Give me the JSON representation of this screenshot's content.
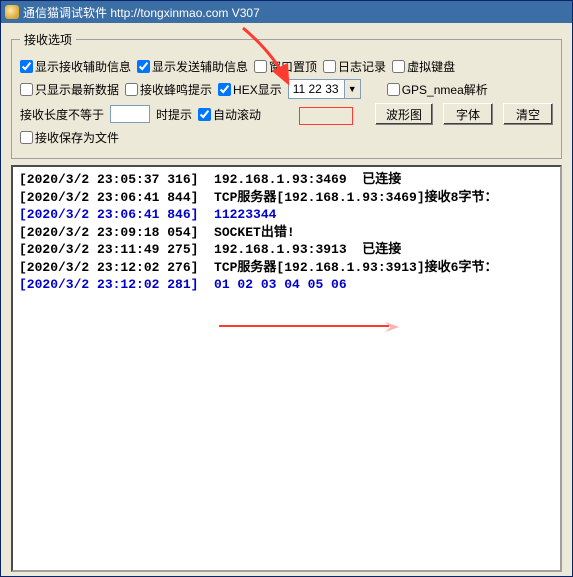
{
  "title": "通信猫调试软件  http://tongxinmao.com  V307",
  "options": {
    "legend": "接收选项",
    "row1": {
      "show_recv_aux": {
        "label": "显示接收辅助信息",
        "checked": true
      },
      "show_send_aux": {
        "label": "显示发送辅助信息",
        "checked": true
      },
      "window_top": {
        "label": "窗口置顶",
        "checked": false
      },
      "log_record": {
        "label": "日志记录",
        "checked": false
      },
      "virtual_kb": {
        "label": "虚拟键盘",
        "checked": false
      }
    },
    "row2": {
      "only_latest": {
        "label": "只显示最新数据",
        "checked": false
      },
      "beep": {
        "label": "接收蜂鸣提示",
        "checked": false
      },
      "hex": {
        "label": "HEX显示",
        "checked": true
      },
      "combo_value": "11 22 33",
      "gps": {
        "label": "GPS_nmea解析",
        "checked": false
      }
    },
    "row3": {
      "len_ne_label": "接收长度不等于",
      "len_ne_value": "",
      "time_tip_label": "时提示",
      "auto_scroll": {
        "label": "自动滚动",
        "checked": true
      },
      "btn_wave": "波形图",
      "btn_font": "字体",
      "btn_clear": "清空"
    },
    "row4": {
      "save_as_file": {
        "label": "接收保存为文件",
        "checked": false
      }
    }
  },
  "log": [
    {
      "cls": "black",
      "text": "[2020/3/2 23:05:37 316]  192.168.1.93:3469  已连接"
    },
    {
      "cls": "black",
      "text": "[2020/3/2 23:06:41 844]  TCP服务器[192.168.1.93:3469]接收8字节："
    },
    {
      "cls": "blue",
      "text": "[2020/3/2 23:06:41 846]  11223344"
    },
    {
      "cls": "black",
      "text": "[2020/3/2 23:09:18 054]  SOCKET出错!"
    },
    {
      "cls": "black",
      "text": "[2020/3/2 23:11:49 275]  192.168.1.93:3913  已连接"
    },
    {
      "cls": "black",
      "text": "[2020/3/2 23:12:02 276]  TCP服务器[192.168.1.93:3913]接收6字节："
    },
    {
      "cls": "blue",
      "text": "[2020/3/2 23:12:02 281]  01 02 03 04 05 06"
    }
  ]
}
